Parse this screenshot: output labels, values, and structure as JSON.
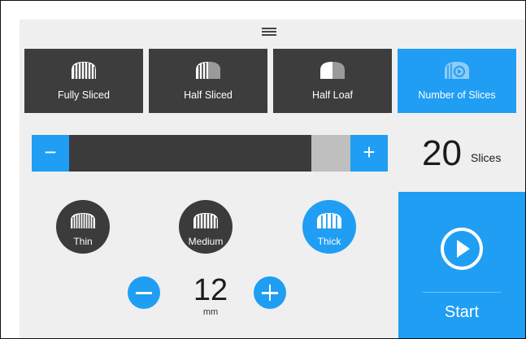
{
  "modes": [
    {
      "label": "Fully Sliced",
      "icon": "fully-sliced-loaf-icon",
      "active": false
    },
    {
      "label": "Half Sliced",
      "icon": "half-sliced-loaf-icon",
      "active": false
    },
    {
      "label": "Half Loaf",
      "icon": "half-loaf-icon",
      "active": false
    },
    {
      "label": "Number of Slices",
      "icon": "number-of-slices-icon",
      "active": true
    }
  ],
  "slices": {
    "minus_label": "−",
    "plus_label": "+",
    "value": "20",
    "unit": "Slices",
    "fill_fraction": 0.86
  },
  "thickness": {
    "options": [
      {
        "label": "Thin",
        "active": false
      },
      {
        "label": "Medium",
        "active": false
      },
      {
        "label": "Thick",
        "active": true
      }
    ],
    "value": "12",
    "unit": "mm"
  },
  "start": {
    "label": "Start",
    "icon": "play-icon"
  },
  "colors": {
    "accent": "#1f9ef4",
    "dark": "#3b3b3b",
    "background": "#efefef"
  }
}
